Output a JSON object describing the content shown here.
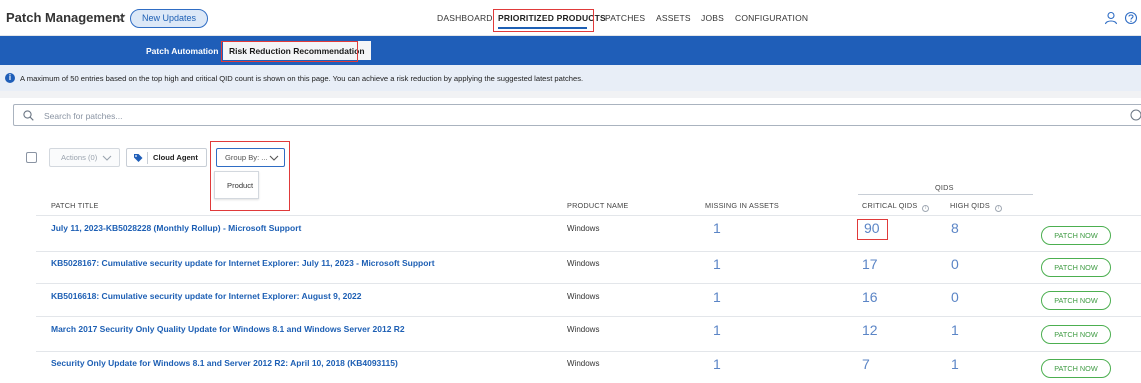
{
  "header": {
    "app_title": "Patch Management",
    "new_updates_label": "New Updates",
    "nav": [
      {
        "label": "DASHBOARD",
        "active": false
      },
      {
        "label": "PRIORITIZED PRODUCTS",
        "active": true
      },
      {
        "label": "PATCHES",
        "active": false
      },
      {
        "label": "ASSETS",
        "active": false
      },
      {
        "label": "JOBS",
        "active": false
      },
      {
        "label": "CONFIGURATION",
        "active": false
      }
    ],
    "icons": [
      "user-icon",
      "help-icon"
    ]
  },
  "subnav": {
    "tabs": [
      {
        "label": "Patch Automation",
        "active": false
      },
      {
        "label": "Risk Reduction Recommendation",
        "active": true
      }
    ]
  },
  "banner": {
    "icon": "info-icon",
    "text": "A maximum of 50 entries based on the top high and critical QID count is shown on this page. You can achieve a risk reduction by applying the suggested latest patches."
  },
  "search": {
    "placeholder": "Search for patches..."
  },
  "toolbar": {
    "actions_label": "Actions (0)",
    "tag_label": "Cloud Agent",
    "groupby_label": "Group By: ...",
    "groupby_options": [
      "Product"
    ]
  },
  "table": {
    "group_header": "QIDS",
    "columns": {
      "patch_title": "PATCH TITLE",
      "product_name": "PRODUCT NAME",
      "missing_in_assets": "MISSING IN ASSETS",
      "critical_qids": "CRITICAL QIDS",
      "high_qids": "HIGH QIDS"
    },
    "action_label": "PATCH NOW",
    "rows": [
      {
        "title": "July 11, 2023-KB5028228 (Monthly Rollup) - Microsoft Support",
        "product": "Windows",
        "missing": "1",
        "critical": "90",
        "high": "8"
      },
      {
        "title": "KB5028167: Cumulative security update for Internet Explorer: July 11, 2023 - Microsoft Support",
        "product": "Windows",
        "missing": "1",
        "critical": "17",
        "high": "0"
      },
      {
        "title": "KB5016618: Cumulative security update for Internet Explorer: August 9, 2022",
        "product": "Windows",
        "missing": "1",
        "critical": "16",
        "high": "0"
      },
      {
        "title": "March 2017 Security Only Quality Update for Windows 8.1 and Windows Server 2012 R2",
        "product": "Windows",
        "missing": "1",
        "critical": "12",
        "high": "1"
      },
      {
        "title": "Security Only Update for Windows 8.1 and Server 2012 R2: April 10, 2018 (KB4093115)",
        "product": "Windows",
        "missing": "1",
        "critical": "7",
        "high": "1"
      }
    ]
  },
  "colors": {
    "brand_blue": "#1f5eb8",
    "link_blue": "#1d5fb4",
    "highlight_red": "#e03a3a",
    "patch_green": "#4caf50"
  }
}
